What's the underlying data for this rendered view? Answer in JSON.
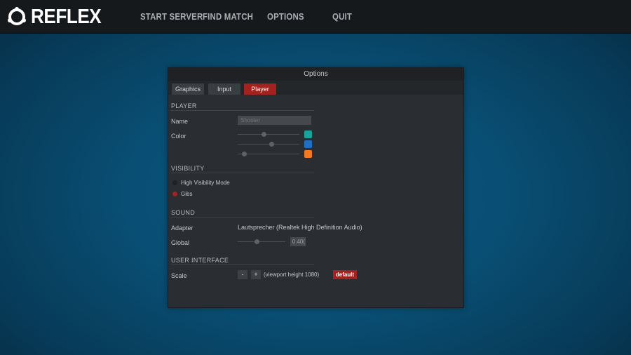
{
  "header": {
    "logo_text": "REFLEX",
    "nav": [
      {
        "label": "START SERVER"
      },
      {
        "label": "FIND MATCH"
      },
      {
        "label": "OPTIONS"
      },
      {
        "label": "QUIT"
      }
    ]
  },
  "options": {
    "title": "Options",
    "tabs": [
      {
        "label": "Graphics",
        "active": false
      },
      {
        "label": "Input",
        "active": false
      },
      {
        "label": "Player",
        "active": true
      }
    ],
    "player": {
      "section_label": "PLAYER",
      "name_label": "Name",
      "name_placeholder": "Shooter",
      "color_label": "Color",
      "color_sliders": [
        {
          "value": 0.42,
          "color": "#1aa39a"
        },
        {
          "value": 0.55,
          "color": "#1f6fc4"
        },
        {
          "value": 0.1,
          "color": "#f27b1f"
        }
      ]
    },
    "visibility": {
      "section_label": "VISIBILITY",
      "options": [
        {
          "label": "High Visibility Mode",
          "checked": false
        },
        {
          "label": "Gibs",
          "checked": true
        }
      ]
    },
    "sound": {
      "section_label": "SOUND",
      "adapter_label": "Adapter",
      "adapter_value": "Lautsprecher (Realtek High Definition Audio)",
      "global_label": "Global",
      "global_value_text": "0.40(",
      "global_value": 0.4
    },
    "ui": {
      "section_label": "USER INTERFACE",
      "scale_label": "Scale",
      "minus_label": "-",
      "plus_label": "+",
      "scale_value": "(viewport height 1080)",
      "default_label": "default"
    }
  },
  "colors": {
    "accent_red": "#a2221f",
    "background_blue": "#094d72",
    "topbar": "#16191c",
    "panel": "#2a2d31"
  }
}
